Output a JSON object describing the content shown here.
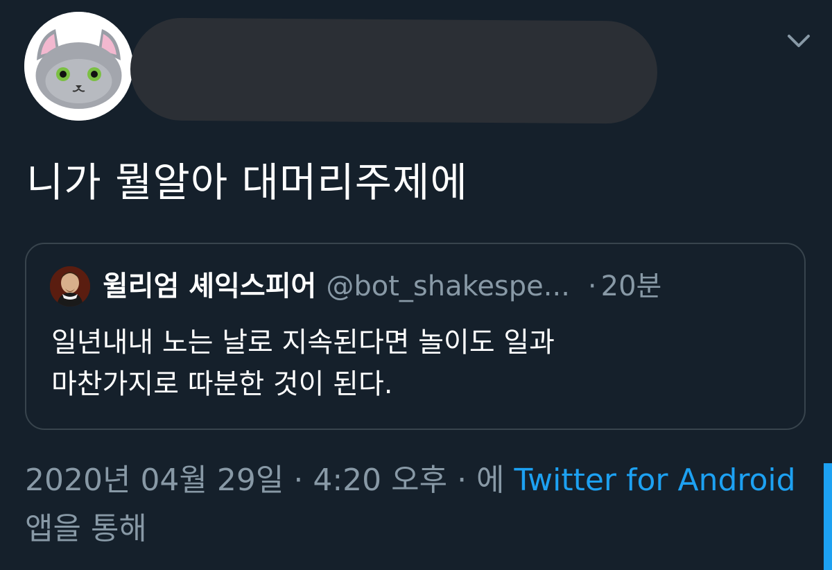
{
  "header": {
    "avatar_icon": "gray-cat-avatar",
    "menu_icon": "chevron-down-icon"
  },
  "tweet": {
    "text": "니가 뭘알아 대머리주제에"
  },
  "quoted_tweet": {
    "avatar_icon": "shakespeare-portrait-avatar",
    "display_name": "윌리엄 셰익스피어",
    "handle": "@bot_shakespe...",
    "separator": "·",
    "time": "20분",
    "text": "일년내내 노는 날로 지속된다면 놀이도 일과\n마찬가지로 따분한 것이 된다."
  },
  "meta": {
    "timestamp": "2020년 04월 29일 · 4:20 오후 · 에",
    "source": "Twitter for Android",
    "suffix": "앱을 통해"
  },
  "colors": {
    "background": "#15202b",
    "muted": "#8899a6",
    "link": "#1da1f2",
    "border": "#38444d"
  }
}
